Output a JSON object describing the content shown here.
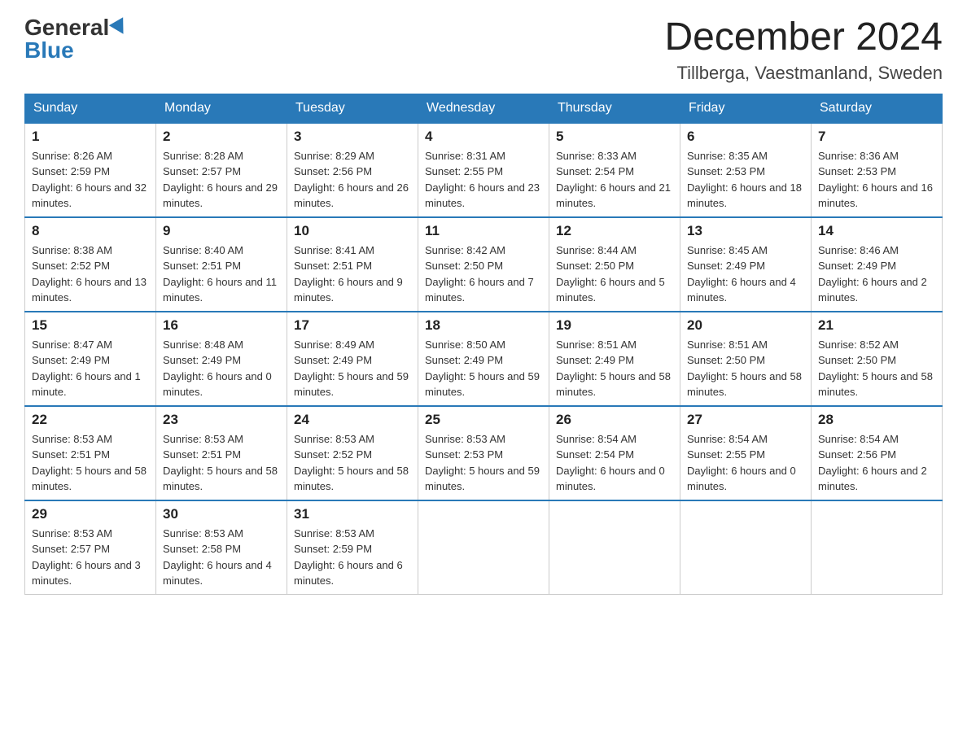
{
  "logo": {
    "general": "General",
    "blue": "Blue"
  },
  "title": "December 2024",
  "location": "Tillberga, Vaestmanland, Sweden",
  "weekdays": [
    "Sunday",
    "Monday",
    "Tuesday",
    "Wednesday",
    "Thursday",
    "Friday",
    "Saturday"
  ],
  "weeks": [
    [
      {
        "day": "1",
        "sunrise": "8:26 AM",
        "sunset": "2:59 PM",
        "daylight": "6 hours and 32 minutes."
      },
      {
        "day": "2",
        "sunrise": "8:28 AM",
        "sunset": "2:57 PM",
        "daylight": "6 hours and 29 minutes."
      },
      {
        "day": "3",
        "sunrise": "8:29 AM",
        "sunset": "2:56 PM",
        "daylight": "6 hours and 26 minutes."
      },
      {
        "day": "4",
        "sunrise": "8:31 AM",
        "sunset": "2:55 PM",
        "daylight": "6 hours and 23 minutes."
      },
      {
        "day": "5",
        "sunrise": "8:33 AM",
        "sunset": "2:54 PM",
        "daylight": "6 hours and 21 minutes."
      },
      {
        "day": "6",
        "sunrise": "8:35 AM",
        "sunset": "2:53 PM",
        "daylight": "6 hours and 18 minutes."
      },
      {
        "day": "7",
        "sunrise": "8:36 AM",
        "sunset": "2:53 PM",
        "daylight": "6 hours and 16 minutes."
      }
    ],
    [
      {
        "day": "8",
        "sunrise": "8:38 AM",
        "sunset": "2:52 PM",
        "daylight": "6 hours and 13 minutes."
      },
      {
        "day": "9",
        "sunrise": "8:40 AM",
        "sunset": "2:51 PM",
        "daylight": "6 hours and 11 minutes."
      },
      {
        "day": "10",
        "sunrise": "8:41 AM",
        "sunset": "2:51 PM",
        "daylight": "6 hours and 9 minutes."
      },
      {
        "day": "11",
        "sunrise": "8:42 AM",
        "sunset": "2:50 PM",
        "daylight": "6 hours and 7 minutes."
      },
      {
        "day": "12",
        "sunrise": "8:44 AM",
        "sunset": "2:50 PM",
        "daylight": "6 hours and 5 minutes."
      },
      {
        "day": "13",
        "sunrise": "8:45 AM",
        "sunset": "2:49 PM",
        "daylight": "6 hours and 4 minutes."
      },
      {
        "day": "14",
        "sunrise": "8:46 AM",
        "sunset": "2:49 PM",
        "daylight": "6 hours and 2 minutes."
      }
    ],
    [
      {
        "day": "15",
        "sunrise": "8:47 AM",
        "sunset": "2:49 PM",
        "daylight": "6 hours and 1 minute."
      },
      {
        "day": "16",
        "sunrise": "8:48 AM",
        "sunset": "2:49 PM",
        "daylight": "6 hours and 0 minutes."
      },
      {
        "day": "17",
        "sunrise": "8:49 AM",
        "sunset": "2:49 PM",
        "daylight": "5 hours and 59 minutes."
      },
      {
        "day": "18",
        "sunrise": "8:50 AM",
        "sunset": "2:49 PM",
        "daylight": "5 hours and 59 minutes."
      },
      {
        "day": "19",
        "sunrise": "8:51 AM",
        "sunset": "2:49 PM",
        "daylight": "5 hours and 58 minutes."
      },
      {
        "day": "20",
        "sunrise": "8:51 AM",
        "sunset": "2:50 PM",
        "daylight": "5 hours and 58 minutes."
      },
      {
        "day": "21",
        "sunrise": "8:52 AM",
        "sunset": "2:50 PM",
        "daylight": "5 hours and 58 minutes."
      }
    ],
    [
      {
        "day": "22",
        "sunrise": "8:53 AM",
        "sunset": "2:51 PM",
        "daylight": "5 hours and 58 minutes."
      },
      {
        "day": "23",
        "sunrise": "8:53 AM",
        "sunset": "2:51 PM",
        "daylight": "5 hours and 58 minutes."
      },
      {
        "day": "24",
        "sunrise": "8:53 AM",
        "sunset": "2:52 PM",
        "daylight": "5 hours and 58 minutes."
      },
      {
        "day": "25",
        "sunrise": "8:53 AM",
        "sunset": "2:53 PM",
        "daylight": "5 hours and 59 minutes."
      },
      {
        "day": "26",
        "sunrise": "8:54 AM",
        "sunset": "2:54 PM",
        "daylight": "6 hours and 0 minutes."
      },
      {
        "day": "27",
        "sunrise": "8:54 AM",
        "sunset": "2:55 PM",
        "daylight": "6 hours and 0 minutes."
      },
      {
        "day": "28",
        "sunrise": "8:54 AM",
        "sunset": "2:56 PM",
        "daylight": "6 hours and 2 minutes."
      }
    ],
    [
      {
        "day": "29",
        "sunrise": "8:53 AM",
        "sunset": "2:57 PM",
        "daylight": "6 hours and 3 minutes."
      },
      {
        "day": "30",
        "sunrise": "8:53 AM",
        "sunset": "2:58 PM",
        "daylight": "6 hours and 4 minutes."
      },
      {
        "day": "31",
        "sunrise": "8:53 AM",
        "sunset": "2:59 PM",
        "daylight": "6 hours and 6 minutes."
      },
      null,
      null,
      null,
      null
    ]
  ]
}
